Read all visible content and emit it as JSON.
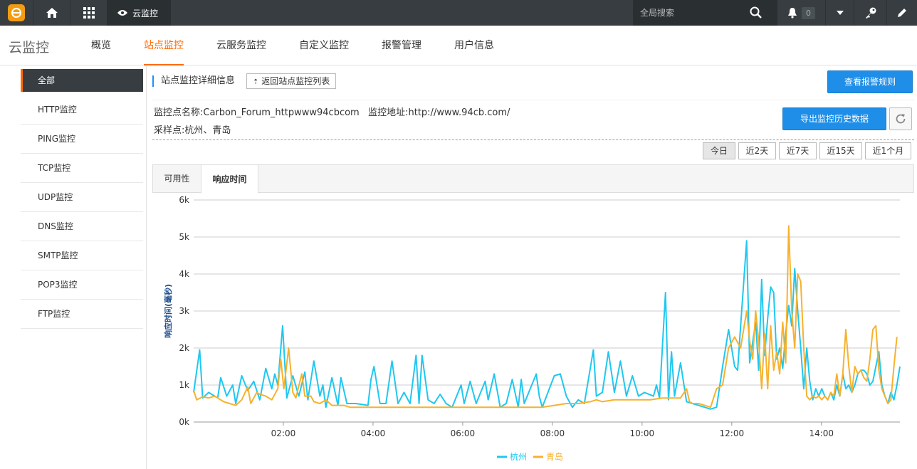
{
  "topbar": {
    "product_label": "云监控",
    "search_placeholder": "全局搜索",
    "notification_count": "0"
  },
  "nav": {
    "brand": "云监控",
    "tabs": [
      {
        "label": "概览"
      },
      {
        "label": "站点监控",
        "active": true
      },
      {
        "label": "云服务监控"
      },
      {
        "label": "自定义监控"
      },
      {
        "label": "报警管理"
      },
      {
        "label": "用户信息"
      }
    ]
  },
  "sidebar": {
    "items": [
      {
        "label": "全部",
        "active": true
      },
      {
        "label": "HTTP监控"
      },
      {
        "label": "PING监控"
      },
      {
        "label": "TCP监控"
      },
      {
        "label": "UDP监控"
      },
      {
        "label": "DNS监控"
      },
      {
        "label": "SMTP监控"
      },
      {
        "label": "POP3监控"
      },
      {
        "label": "FTP监控"
      }
    ]
  },
  "detail": {
    "title": "站点监控详细信息",
    "back_label": "返回站点监控列表",
    "alarm_rules_label": "查看报警规则",
    "export_label": "导出监控历史数据",
    "site_line": "监控点名称:Carbon_Forum_httpwww94cbcom   监控地址:http://www.94cb.com/",
    "sample_line": "采样点:杭州、青岛"
  },
  "ranges": [
    "今日",
    "近2天",
    "近7天",
    "近15天",
    "近1个月"
  ],
  "chart_tabs": [
    "可用性",
    "响应时间"
  ],
  "colors": {
    "accent": "#ff6a00",
    "blue": "#1e8ee8",
    "series1": "#1ec8f0",
    "series2": "#f6b22e"
  },
  "chart_data": {
    "type": "line",
    "ylabel": "响应时间(毫秒)",
    "ylim": [
      0,
      6000
    ],
    "yticks": [
      "0k",
      "1k",
      "2k",
      "3k",
      "4k",
      "5k",
      "6k"
    ],
    "xlim": [
      "00:00",
      "15:45"
    ],
    "xticks": [
      "02:00",
      "04:00",
      "06:00",
      "08:00",
      "10:00",
      "12:00",
      "14:00"
    ],
    "legend_position": "bottom",
    "series": [
      {
        "name": "杭州",
        "color": "#1ec8f0",
        "points": [
          [
            0,
            800
          ],
          [
            10,
            1950
          ],
          [
            15,
            650
          ],
          [
            25,
            800
          ],
          [
            35,
            700
          ],
          [
            40,
            650
          ],
          [
            45,
            1200
          ],
          [
            55,
            700
          ],
          [
            65,
            1000
          ],
          [
            70,
            500
          ],
          [
            80,
            1250
          ],
          [
            90,
            850
          ],
          [
            100,
            1100
          ],
          [
            110,
            600
          ],
          [
            120,
            1450
          ],
          [
            130,
            900
          ],
          [
            135,
            1300
          ],
          [
            140,
            1000
          ],
          [
            148,
            2600
          ],
          [
            155,
            650
          ],
          [
            165,
            1250
          ],
          [
            175,
            700
          ],
          [
            185,
            1350
          ],
          [
            190,
            600
          ],
          [
            200,
            1650
          ],
          [
            210,
            700
          ],
          [
            215,
            1000
          ],
          [
            220,
            400
          ],
          [
            230,
            1200
          ],
          [
            240,
            450
          ],
          [
            245,
            1200
          ],
          [
            255,
            500
          ],
          [
            270,
            500
          ],
          [
            290,
            450
          ],
          [
            295,
            1150
          ],
          [
            300,
            1500
          ],
          [
            310,
            500
          ],
          [
            320,
            500
          ],
          [
            330,
            1650
          ],
          [
            340,
            500
          ],
          [
            350,
            800
          ],
          [
            360,
            500
          ],
          [
            370,
            1800
          ],
          [
            375,
            500
          ],
          [
            380,
            1800
          ],
          [
            390,
            600
          ],
          [
            400,
            500
          ],
          [
            410,
            750
          ],
          [
            420,
            500
          ],
          [
            430,
            400
          ],
          [
            445,
            1000
          ],
          [
            450,
            500
          ],
          [
            460,
            1100
          ],
          [
            470,
            500
          ],
          [
            485,
            1100
          ],
          [
            490,
            600
          ],
          [
            500,
            1300
          ],
          [
            510,
            400
          ],
          [
            520,
            500
          ],
          [
            530,
            1150
          ],
          [
            540,
            400
          ],
          [
            545,
            1150
          ],
          [
            550,
            500
          ],
          [
            570,
            1300
          ],
          [
            575,
            700
          ],
          [
            580,
            400
          ],
          [
            600,
            1250
          ],
          [
            610,
            1300
          ],
          [
            620,
            700
          ],
          [
            630,
            400
          ],
          [
            640,
            600
          ],
          [
            650,
            500
          ],
          [
            665,
            1950
          ],
          [
            670,
            700
          ],
          [
            680,
            800
          ],
          [
            690,
            1900
          ],
          [
            700,
            800
          ],
          [
            710,
            1650
          ],
          [
            720,
            700
          ],
          [
            730,
            1250
          ],
          [
            740,
            700
          ],
          [
            750,
            800
          ],
          [
            765,
            700
          ],
          [
            770,
            1000
          ],
          [
            775,
            650
          ],
          [
            785,
            3500
          ],
          [
            790,
            600
          ],
          [
            795,
            1900
          ],
          [
            800,
            700
          ],
          [
            810,
            1600
          ],
          [
            820,
            550
          ],
          [
            830,
            500
          ],
          [
            840,
            450
          ],
          [
            850,
            400
          ],
          [
            860,
            350
          ],
          [
            870,
            400
          ],
          [
            880,
            1500
          ],
          [
            890,
            2500
          ],
          [
            900,
            1500
          ],
          [
            905,
            1400
          ],
          [
            910,
            2600
          ],
          [
            920,
            4900
          ],
          [
            925,
            1600
          ],
          [
            935,
            2700
          ],
          [
            940,
            1400
          ],
          [
            945,
            3850
          ],
          [
            950,
            1800
          ],
          [
            955,
            2800
          ],
          [
            960,
            3650
          ],
          [
            965,
            3500
          ],
          [
            970,
            1700
          ],
          [
            975,
            2000
          ],
          [
            980,
            1450
          ],
          [
            985,
            2400
          ],
          [
            990,
            3150
          ],
          [
            995,
            2600
          ],
          [
            1000,
            4150
          ],
          [
            1005,
            3000
          ],
          [
            1010,
            2000
          ],
          [
            1015,
            900
          ],
          [
            1020,
            2000
          ],
          [
            1025,
            1100
          ],
          [
            1030,
            600
          ],
          [
            1035,
            900
          ],
          [
            1040,
            700
          ],
          [
            1045,
            900
          ],
          [
            1050,
            700
          ],
          [
            1055,
            600
          ],
          [
            1060,
            800
          ],
          [
            1065,
            600
          ],
          [
            1070,
            1000
          ],
          [
            1075,
            700
          ],
          [
            1080,
            1300
          ],
          [
            1085,
            900
          ],
          [
            1090,
            1000
          ],
          [
            1095,
            800
          ],
          [
            1100,
            1000
          ],
          [
            1105,
            1300
          ],
          [
            1110,
            1400
          ],
          [
            1115,
            1400
          ],
          [
            1120,
            1300
          ],
          [
            1125,
            1000
          ],
          [
            1130,
            1100
          ],
          [
            1135,
            1500
          ],
          [
            1140,
            1900
          ],
          [
            1145,
            1000
          ],
          [
            1150,
            700
          ],
          [
            1155,
            500
          ],
          [
            1160,
            800
          ],
          [
            1165,
            600
          ],
          [
            1170,
            1000
          ],
          [
            1175,
            1500
          ]
        ]
      },
      {
        "name": "青岛",
        "color": "#f6b22e",
        "points": [
          [
            0,
            850
          ],
          [
            5,
            600
          ],
          [
            15,
            680
          ],
          [
            25,
            650
          ],
          [
            35,
            700
          ],
          [
            40,
            650
          ],
          [
            50,
            550
          ],
          [
            60,
            500
          ],
          [
            70,
            450
          ],
          [
            80,
            600
          ],
          [
            90,
            950
          ],
          [
            95,
            500
          ],
          [
            105,
            800
          ],
          [
            110,
            750
          ],
          [
            120,
            700
          ],
          [
            130,
            600
          ],
          [
            140,
            900
          ],
          [
            145,
            1700
          ],
          [
            150,
            900
          ],
          [
            158,
            2000
          ],
          [
            165,
            800
          ],
          [
            170,
            650
          ],
          [
            180,
            1300
          ],
          [
            185,
            700
          ],
          [
            195,
            700
          ],
          [
            200,
            550
          ],
          [
            210,
            500
          ],
          [
            220,
            600
          ],
          [
            230,
            450
          ],
          [
            240,
            450
          ],
          [
            250,
            450
          ],
          [
            260,
            400
          ],
          [
            270,
            400
          ],
          [
            280,
            400
          ],
          [
            290,
            400
          ],
          [
            300,
            400
          ],
          [
            320,
            400
          ],
          [
            340,
            400
          ],
          [
            360,
            400
          ],
          [
            380,
            400
          ],
          [
            400,
            400
          ],
          [
            420,
            400
          ],
          [
            440,
            400
          ],
          [
            460,
            400
          ],
          [
            480,
            400
          ],
          [
            500,
            400
          ],
          [
            520,
            400
          ],
          [
            540,
            400
          ],
          [
            560,
            400
          ],
          [
            580,
            400
          ],
          [
            600,
            450
          ],
          [
            620,
            500
          ],
          [
            640,
            500
          ],
          [
            660,
            550
          ],
          [
            670,
            600
          ],
          [
            680,
            550
          ],
          [
            700,
            600
          ],
          [
            720,
            600
          ],
          [
            740,
            600
          ],
          [
            760,
            600
          ],
          [
            780,
            650
          ],
          [
            790,
            650
          ],
          [
            800,
            650
          ],
          [
            810,
            650
          ],
          [
            820,
            900
          ],
          [
            825,
            550
          ],
          [
            830,
            500
          ],
          [
            840,
            500
          ],
          [
            850,
            450
          ],
          [
            860,
            400
          ],
          [
            870,
            900
          ],
          [
            880,
            1000
          ],
          [
            890,
            2000
          ],
          [
            900,
            2300
          ],
          [
            910,
            2000
          ],
          [
            920,
            3000
          ],
          [
            925,
            2200
          ],
          [
            930,
            1700
          ],
          [
            935,
            3000
          ],
          [
            940,
            2200
          ],
          [
            945,
            900
          ],
          [
            950,
            2400
          ],
          [
            955,
            900
          ],
          [
            960,
            2600
          ],
          [
            965,
            1400
          ],
          [
            970,
            1900
          ],
          [
            975,
            1300
          ],
          [
            980,
            2700
          ],
          [
            985,
            1600
          ],
          [
            990,
            5300
          ],
          [
            995,
            3000
          ],
          [
            1000,
            2000
          ],
          [
            1005,
            4000
          ],
          [
            1010,
            3800
          ],
          [
            1015,
            2000
          ],
          [
            1020,
            700
          ],
          [
            1025,
            600
          ],
          [
            1030,
            700
          ],
          [
            1035,
            650
          ],
          [
            1040,
            700
          ],
          [
            1045,
            600
          ],
          [
            1050,
            700
          ],
          [
            1055,
            600
          ],
          [
            1060,
            800
          ],
          [
            1065,
            700
          ],
          [
            1070,
            1300
          ],
          [
            1075,
            700
          ],
          [
            1080,
            1300
          ],
          [
            1085,
            2500
          ],
          [
            1090,
            1500
          ],
          [
            1095,
            800
          ],
          [
            1100,
            1500
          ],
          [
            1105,
            1300
          ],
          [
            1110,
            1400
          ],
          [
            1115,
            1200
          ],
          [
            1120,
            1100
          ],
          [
            1125,
            1700
          ],
          [
            1130,
            2500
          ],
          [
            1135,
            2600
          ],
          [
            1140,
            1400
          ],
          [
            1145,
            900
          ],
          [
            1150,
            700
          ],
          [
            1155,
            500
          ],
          [
            1160,
            600
          ],
          [
            1165,
            1500
          ],
          [
            1170,
            2300
          ]
        ]
      }
    ]
  }
}
